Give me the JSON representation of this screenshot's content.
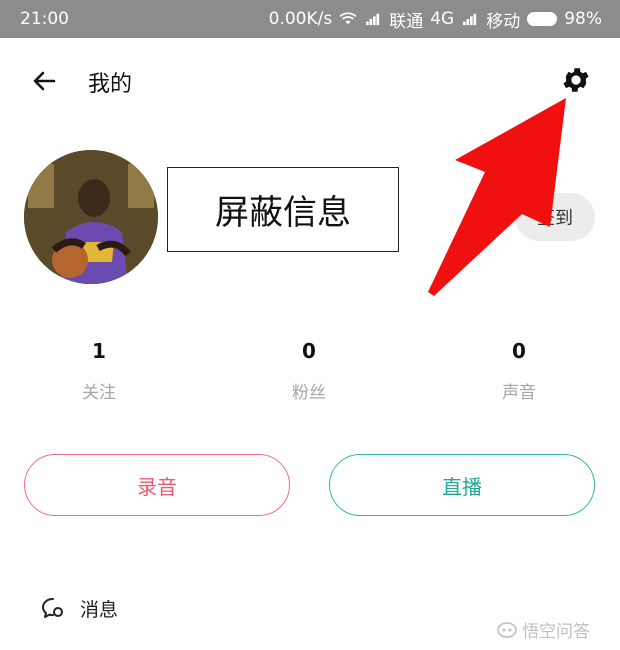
{
  "status_bar": {
    "time": "21:00",
    "speed": "0.00K/s",
    "carrier1": "联通",
    "network": "4G",
    "carrier2": "移动",
    "battery": "98%"
  },
  "header": {
    "title": "我的",
    "icons": {
      "back": "arrow-left-icon",
      "settings": "gear-icon"
    }
  },
  "profile": {
    "redacted_label": "屏蔽信息",
    "signin_label": "签到"
  },
  "stats": [
    {
      "value": "1",
      "label": "关注"
    },
    {
      "value": "0",
      "label": "粉丝"
    },
    {
      "value": "0",
      "label": "声音"
    }
  ],
  "actions": {
    "record_label": "录音",
    "live_label": "直播"
  },
  "menu": {
    "messages_label": "消息"
  },
  "watermark": {
    "text": "悟空问答"
  },
  "colors": {
    "status_bar_bg": "#8c8c8c",
    "record_accent": "#ee5a6f",
    "live_accent": "#20a894",
    "annotation_arrow": "#f01010"
  }
}
